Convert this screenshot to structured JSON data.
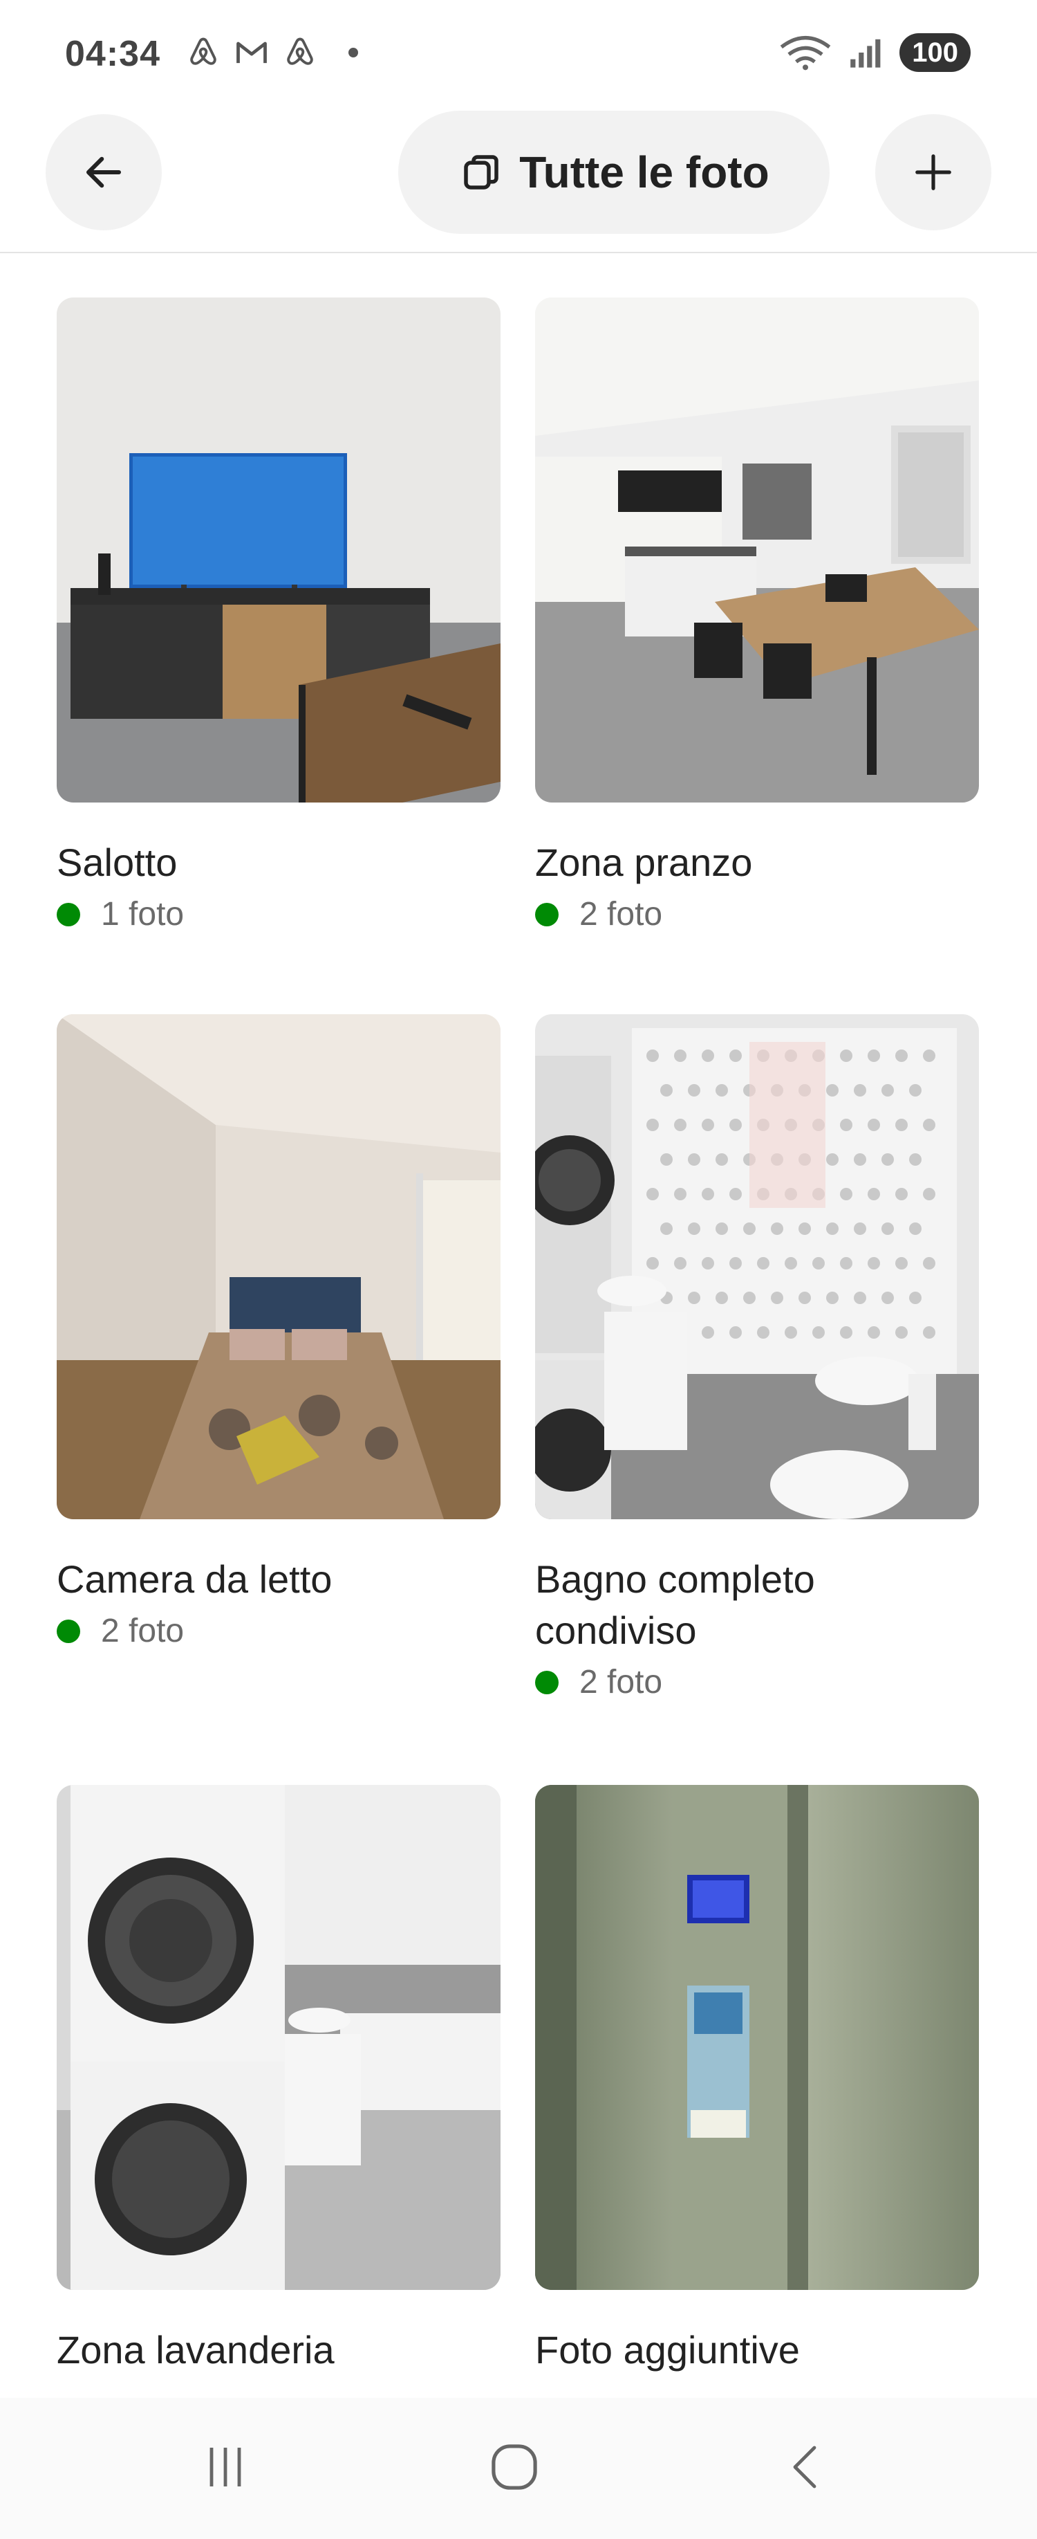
{
  "status_bar": {
    "time": "04:34",
    "left_icons": [
      "airbnb-icon",
      "gmail-icon",
      "airbnb-icon"
    ],
    "battery": "100"
  },
  "header": {
    "all_photos_label": "Tutte le foto"
  },
  "rooms": [
    {
      "title": "Salotto",
      "count": "1 foto"
    },
    {
      "title": "Zona pranzo",
      "count": "2 foto"
    },
    {
      "title": "Camera da letto",
      "count": "2 foto"
    },
    {
      "title": "Bagno completo condiviso",
      "count": "2 foto"
    },
    {
      "title": "Zona lavanderia",
      "count": ""
    },
    {
      "title": "Foto aggiuntive",
      "count": ""
    }
  ],
  "colors": {
    "status_dot": "#008a05",
    "button_bg": "#f2f2f2",
    "text_primary": "#222222",
    "text_secondary": "#6a6a6a"
  }
}
